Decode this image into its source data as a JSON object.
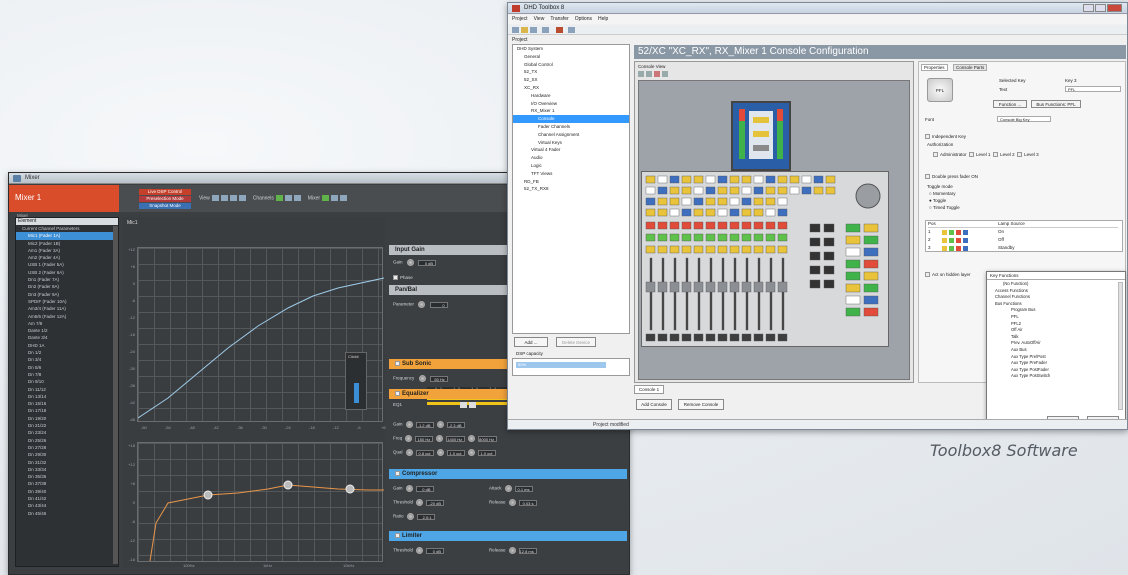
{
  "mixer": {
    "window_title": "Mixer",
    "name": "Mixer 1",
    "modes": [
      "Live DSP Control",
      "Preselection Mode",
      "Snapshot Mode"
    ],
    "toolbar": {
      "view": "View",
      "channels": "Channels",
      "mixer": "Mixer"
    },
    "sidebar": {
      "top_label": "Mixer",
      "header": "Element",
      "items": [
        "Current Channel Parameters",
        "Mic1 (Fader 1A)",
        "Mic2 (Fader 1B)",
        "Am1 (Fader 3A)",
        "Am2 (Fader 4A)",
        "USB 1 (Fader 5A)",
        "USB 2 (Fader 6A)",
        "Dn1 (Fader 7A)",
        "Dn2 (Fader 8A)",
        "Dn3 (Fader 9A)",
        "SPDIF (Fader 10A)",
        "Am3/4 (Fader 11A)",
        "Am5/6 (Fader 12A)",
        "Am 7/8",
        "Dante 1/2",
        "Dante 3/4",
        "DHD 1A",
        "Dn 1/2",
        "Dn 3/4",
        "Dn 5/6",
        "Dn 7/8",
        "Dn 9/10",
        "Dn 11/12",
        "Dn 13/14",
        "Dn 15/16",
        "Dn 17/18",
        "Dn 19/20",
        "Dn 21/22",
        "Dn 23/24",
        "Dn 25/26",
        "Dn 27/28",
        "Dn 29/30",
        "Dn 31/32",
        "Dn 33/34",
        "Dn 35/36",
        "Dn 37/38",
        "Dn 39/40",
        "Dn 41/42",
        "Dn 43/44",
        "Dn 45/46"
      ],
      "selected_index": 1
    },
    "channel_label": "Mic1",
    "meter_label": "Clickit",
    "graph1": {
      "yticks": [
        "+12",
        "+6",
        "0",
        "-6",
        "-12",
        "-18",
        "-24",
        "-30",
        "-36",
        "-42",
        "-48"
      ],
      "xticks": [
        "-60",
        "-54",
        "-48",
        "-42",
        "-36",
        "-30",
        "-24",
        "-18",
        "-12",
        "-6",
        "+6"
      ]
    },
    "graph2": {
      "yticks": [
        "+18",
        "+12",
        "+6",
        "0",
        "-6",
        "-12",
        "-18"
      ],
      "xticks": [
        "100Hz",
        "1kHz",
        "10kHz"
      ]
    },
    "level_ticks": "-60  -48  -36  -24  -12  0",
    "panels": {
      "input_gain": {
        "title": "Input Gain",
        "gain_label": "Gain",
        "gain_value": "0 dB",
        "phase_label": "Phase"
      },
      "pan_bal": {
        "title": "Pan/Bal",
        "param_label": "Parameter",
        "param_value": "0"
      },
      "sub_sonic": {
        "title": "Sub Sonic",
        "freq_label": "Frequency",
        "freq_value": "50 Hz"
      },
      "equalizer": {
        "title": "Equalizer",
        "band": "EQ1",
        "gain_label": "Gain",
        "freq_label": "Freq",
        "qual_label": "Qual",
        "gain_values": [
          "-1.2 dB",
          "-2.3 dB"
        ],
        "freq_values": [
          "150 Hz",
          "1400 Hz",
          "8000 Hz"
        ],
        "qual_values": [
          "0.8 oct",
          "1.0 oct",
          "1.0 oct"
        ]
      },
      "compressor": {
        "title": "Compressor",
        "gain_label": "Gain",
        "threshold_label": "Threshold",
        "ratio_label": "Ratio",
        "attack_label": "Attack",
        "release_label": "Release",
        "gain_value": "0 dB",
        "threshold_value": "-20 dB",
        "ratio_value": "2.0:1",
        "attack_value": "0.1 ms",
        "release_value": "0.03 s"
      },
      "limiter": {
        "title": "Limiter",
        "threshold_label": "Threshold",
        "threshold_value": "0 dB",
        "release_label": "Release",
        "release_value": "12.8 ms"
      }
    }
  },
  "toolbox": {
    "window_title": "DHD Toolbox 8",
    "menu": [
      "Project",
      "View",
      "Transfer",
      "Options",
      "Help"
    ],
    "project_label": "Project",
    "tree": [
      "DHD System",
      "General",
      "Global Control",
      "52_TX",
      "52_SX",
      "XC_RX",
      "Hardware",
      "I/O Overview",
      "RX_Mixer 1",
      "Console",
      "Fader Channels",
      "Channel Assignment",
      "Virtual Keys",
      "Virtual 4 Fader",
      "Audio",
      "Logic",
      "TFT Views",
      "RD_FB",
      "52_TX_RX8"
    ],
    "tree_indent": [
      0,
      1,
      1,
      1,
      1,
      1,
      2,
      2,
      2,
      3,
      3,
      3,
      3,
      2,
      2,
      2,
      2,
      1,
      1
    ],
    "tree_selected": 9,
    "add_btn": "Add ...",
    "delete_btn": "Delete Device",
    "dsp_label": "DSP capacity",
    "dsp_value": "90%",
    "config_title": "52/XC \"XC_RX\", RX_Mixer 1 Console Configuration",
    "console_view_label": "Console View",
    "console_tab": "Console 1",
    "add_console": "Add Console",
    "remove_console": "Remove Console",
    "status": "Project modified",
    "properties": {
      "tabs": [
        "Properties",
        "Console Parts"
      ],
      "key_icon": "PFL",
      "selected_key_label": "Selected Key",
      "selected_key_value": "Key 3",
      "text_label": "Text",
      "text_value": "PFL",
      "function_btn": "Function ...",
      "bus_function_btn": "Bus Functions: PFL",
      "font_label": "Font",
      "font_value": "Console Big Key",
      "independent": "Independent Key",
      "authorization": "Authorization",
      "auth_opts": [
        "Administrator",
        "Level 1",
        "Level 2",
        "Level 3"
      ],
      "double_press": "Double press fader ON",
      "toggle_mode": "Toggle mode",
      "modes": [
        "Momentary",
        "Toggle",
        "Timed Toggle"
      ],
      "lamp_headers": [
        "Pos",
        "Lamp Source"
      ],
      "lamps": [
        {
          "pos": "1",
          "label": "On"
        },
        {
          "pos": "2",
          "label": "Off"
        },
        {
          "pos": "3",
          "label": "Standby"
        }
      ],
      "hidden_layer": "Act on hidden layer"
    },
    "key_functions": {
      "title": "Key Functions",
      "items": [
        "(No Function)",
        "Access Functions",
        "Channel Functions",
        "Bus Functions",
        "Program Bus",
        "PFL",
        "PFL2",
        "Off Air",
        "Talk",
        "Prev. AutoOffAir",
        "Aux Bus",
        "Aux Type Pre/Post",
        "Aux Type PreFader",
        "Aux Type PostFader",
        "Aux Type PostSwitch"
      ],
      "select": "Select",
      "cancel": "Cancel"
    }
  },
  "caption": "Toolbox8 Software",
  "colors": {
    "mixer_accent": "#d94d2b",
    "orange_section": "#f2a23a",
    "blue_section": "#4ea6e6",
    "eq_curve": "#e8964a",
    "comp_curve": "#9ecbe8",
    "level_bar": "#f0c418"
  }
}
